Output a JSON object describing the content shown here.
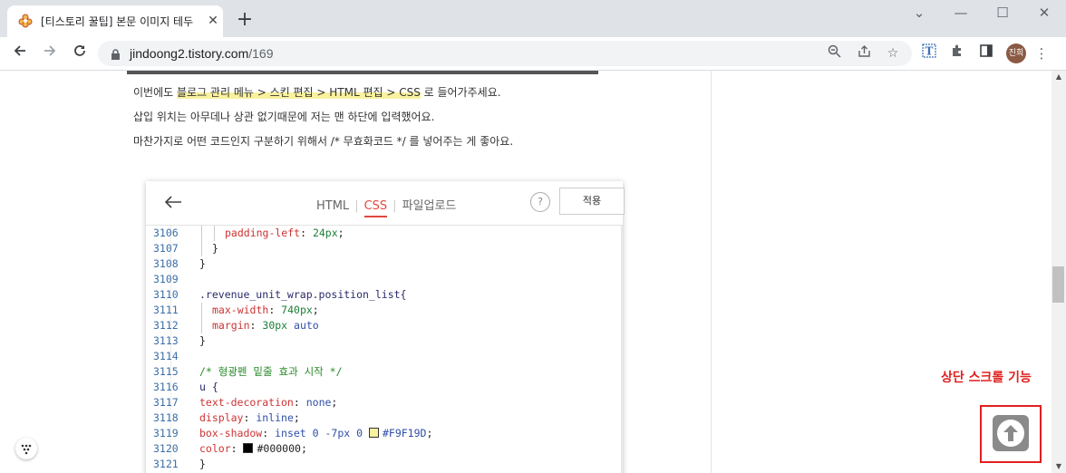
{
  "browser": {
    "tab_title": "[티스토리 꿀팁] 본문 이미지 테두",
    "url_host": "jindoong2.tistory.com",
    "url_path": "/169",
    "avatar_label": "진희"
  },
  "article": {
    "line1_pre": "이번에도 ",
    "line1_hl": "블로그 관리 메뉴 > 스킨 편집 > HTML 편집 > CSS",
    "line1_post": " 로 들어가주세요.",
    "line2": "삽입 위치는 아무데나 상관 없기때문에 저는 맨 하단에 입력했어요.",
    "line3": "마찬가지로 어떤 코드인지 구분하기 위해서 /* 무효화코드 */ 를 넣어주는 게 좋아요."
  },
  "editor": {
    "tab_html": "HTML",
    "tab_css": "CSS",
    "tab_upload": "파일업로드",
    "help": "?",
    "apply_label": "적용",
    "lines": [
      {
        "n": "3106",
        "indent": 2,
        "parts": [
          {
            "t": "padding-left",
            "c": "prop"
          },
          {
            "t": ": ",
            "c": ""
          },
          {
            "t": "24px",
            "c": "num"
          },
          {
            "t": ";",
            "c": ""
          }
        ]
      },
      {
        "n": "3107",
        "indent": 1,
        "parts": [
          {
            "t": "}",
            "c": ""
          }
        ]
      },
      {
        "n": "3108",
        "indent": 0,
        "parts": [
          {
            "t": "}",
            "c": ""
          }
        ]
      },
      {
        "n": "3109",
        "indent": 0,
        "parts": []
      },
      {
        "n": "3110",
        "indent": 0,
        "parts": [
          {
            "t": ".revenue_unit_wrap.position_list{",
            "c": "sel"
          }
        ]
      },
      {
        "n": "3111",
        "indent": 1,
        "parts": [
          {
            "t": "max-width",
            "c": "prop"
          },
          {
            "t": ": ",
            "c": ""
          },
          {
            "t": "740px",
            "c": "num"
          },
          {
            "t": ";",
            "c": ""
          }
        ]
      },
      {
        "n": "3112",
        "indent": 1,
        "parts": [
          {
            "t": "margin",
            "c": "prop"
          },
          {
            "t": ": ",
            "c": ""
          },
          {
            "t": "30px",
            "c": "num"
          },
          {
            "t": " auto",
            "c": "kw"
          }
        ]
      },
      {
        "n": "3113",
        "indent": 0,
        "parts": [
          {
            "t": "}",
            "c": ""
          }
        ]
      },
      {
        "n": "3114",
        "indent": 0,
        "parts": []
      },
      {
        "n": "3115",
        "indent": 0,
        "parts": [
          {
            "t": "/* 형광펜 밑줄 효과 시작 */",
            "c": "cmt"
          }
        ]
      },
      {
        "n": "3116",
        "indent": 0,
        "parts": [
          {
            "t": "u {",
            "c": "sel"
          }
        ]
      },
      {
        "n": "3117",
        "indent": 0,
        "parts": [
          {
            "t": "text-decoration",
            "c": "prop"
          },
          {
            "t": ": ",
            "c": ""
          },
          {
            "t": "none",
            "c": "kw"
          },
          {
            "t": ";",
            "c": ""
          }
        ]
      },
      {
        "n": "3118",
        "indent": 0,
        "parts": [
          {
            "t": "display",
            "c": "prop"
          },
          {
            "t": ": ",
            "c": ""
          },
          {
            "t": "inline",
            "c": "kw"
          },
          {
            "t": ";",
            "c": ""
          }
        ]
      },
      {
        "n": "3119",
        "indent": 0,
        "parts": [
          {
            "t": "box-shadow",
            "c": "prop"
          },
          {
            "t": ": ",
            "c": ""
          },
          {
            "t": "inset 0 -7px 0 ",
            "c": "kw"
          },
          {
            "t": "#F9F19D",
            "c": "kw",
            "swatch": "#F9F19D"
          },
          {
            "t": ";",
            "c": ""
          }
        ]
      },
      {
        "n": "3120",
        "indent": 0,
        "parts": [
          {
            "t": "color",
            "c": "prop"
          },
          {
            "t": ": ",
            "c": ""
          },
          {
            "t": "#000000",
            "c": "",
            "swatch": "#000000"
          },
          {
            "t": ";",
            "c": ""
          }
        ]
      },
      {
        "n": "3121",
        "indent": 0,
        "parts": [
          {
            "t": "}",
            "c": ""
          }
        ]
      }
    ]
  },
  "annotation": {
    "label": "상단 스크롤 기능"
  },
  "colors": {
    "accent_red": "#e02020",
    "css_tab_active": "#e2483d",
    "highlight": "#F9F19D"
  }
}
